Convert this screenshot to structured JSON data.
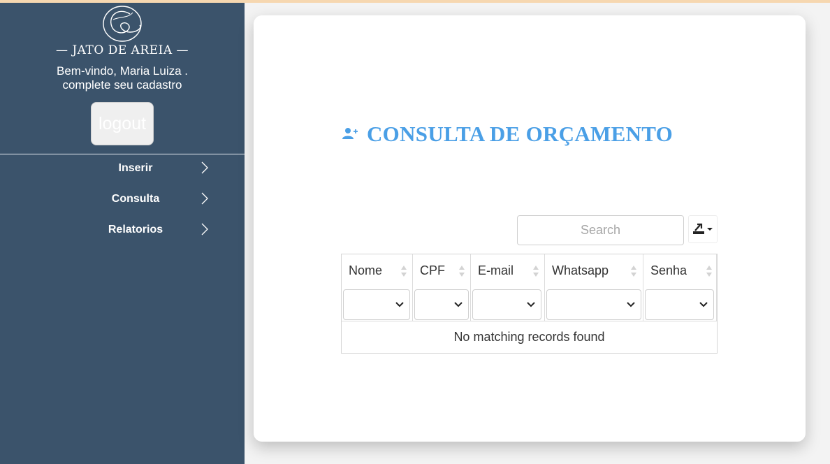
{
  "sidebar": {
    "brand": "— JATO DE AREIA —",
    "welcome_line1": "Bem-vindo, Maria Luiza .",
    "welcome_line2": "complete seu cadastro",
    "logout_label": "logout",
    "items": [
      {
        "label": "Inserir",
        "icon": "chevron-right-icon"
      },
      {
        "label": "Consulta",
        "icon": "chevron-right-icon"
      },
      {
        "label": "Relatorios",
        "icon": "chevron-right-icon"
      }
    ]
  },
  "main": {
    "title": "CONSULTA DE ORÇAMENTO",
    "title_icon": "user-plus-icon",
    "search_placeholder": "Search",
    "export_icon": "export-icon",
    "table": {
      "columns": [
        "Nome",
        "CPF",
        "E-mail",
        "Whatsapp",
        "Senha"
      ],
      "empty_message": "No matching records found"
    }
  },
  "colors": {
    "sidebar_bg": "#3b536b",
    "accent": "#4a9fe6",
    "topbar": "#f6d7b0"
  }
}
